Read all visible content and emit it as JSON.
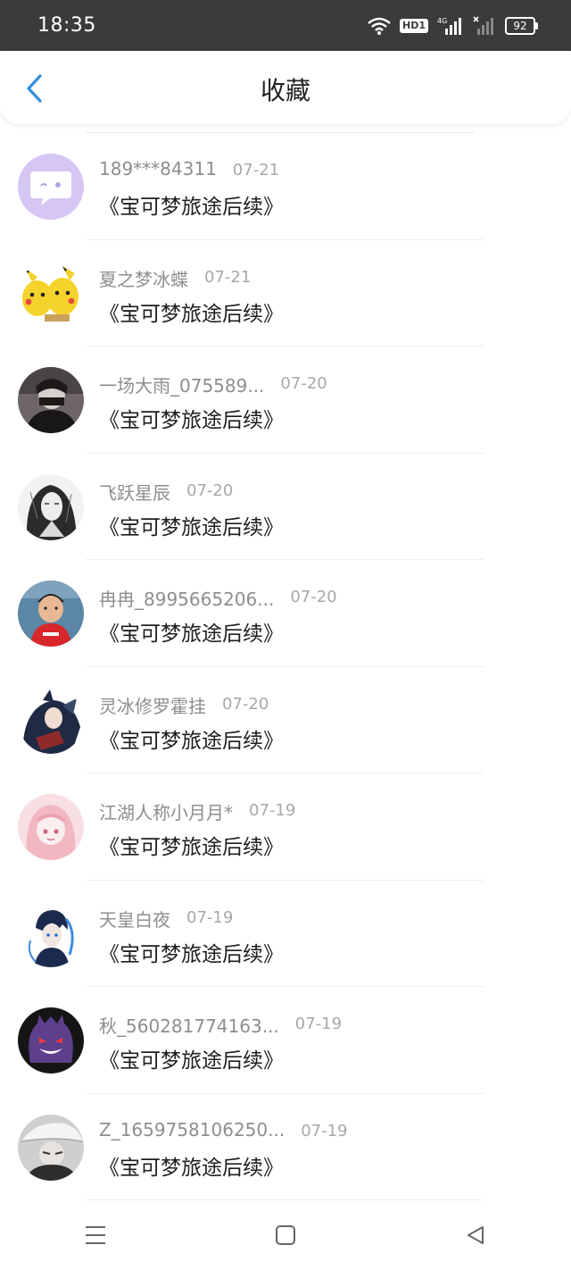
{
  "status": {
    "time": "18:35",
    "network": "4G",
    "hd": "HD1",
    "battery": "92"
  },
  "header": {
    "title": "收藏"
  },
  "items": [
    {
      "user": "189***84311",
      "date": "07-21",
      "title": "《宝可梦旅途后续》",
      "avatar": "chat-bubble-avatar"
    },
    {
      "user": "夏之梦冰蝶",
      "date": "07-21",
      "title": "《宝可梦旅途后续》",
      "avatar": "pikachu-avatar"
    },
    {
      "user": "一场大雨_075589...",
      "date": "07-20",
      "title": "《宝可梦旅途后续》",
      "avatar": "masked-person-avatar"
    },
    {
      "user": "飞跃星辰",
      "date": "07-20",
      "title": "《宝可梦旅途后续》",
      "avatar": "sketch-portrait-avatar"
    },
    {
      "user": "冉冉_8995665206...",
      "date": "07-20",
      "title": "《宝可梦旅途后续》",
      "avatar": "child-photo-avatar"
    },
    {
      "user": "灵冰修罗霍挂",
      "date": "07-20",
      "title": "《宝可梦旅途后续》",
      "avatar": "anime-character-avatar"
    },
    {
      "user": "江湖人称小月月*",
      "date": "07-19",
      "title": "《宝可梦旅途后续》",
      "avatar": "pink-anime-girl-avatar"
    },
    {
      "user": "天皇白夜",
      "date": "07-19",
      "title": "《宝可梦旅途后续》",
      "avatar": "blue-anime-boy-avatar"
    },
    {
      "user": "秋_560281774163...",
      "date": "07-19",
      "title": "《宝可梦旅途后续》",
      "avatar": "gengar-avatar"
    },
    {
      "user": "Z_1659758106250...",
      "date": "07-19",
      "title": "《宝可梦旅途后续》",
      "avatar": "white-hat-character-avatar"
    }
  ],
  "colors": {
    "accent": "#2f8fdd",
    "statusbar": "#3b3b3b"
  }
}
